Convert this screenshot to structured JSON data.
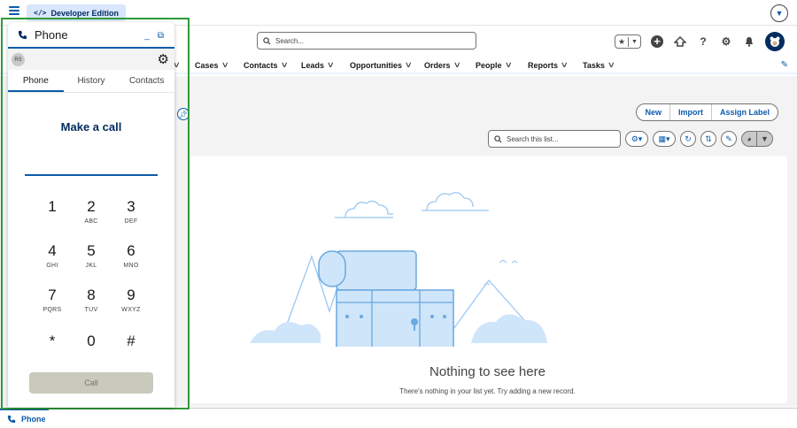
{
  "top": {
    "edition_code": "</>",
    "edition_label": "Developer Edition",
    "help_icon": "chevron-down-icon"
  },
  "header": {
    "search_placeholder": "Search..."
  },
  "nav": {
    "items": [
      {
        "label": "Cases"
      },
      {
        "label": "Contacts"
      },
      {
        "label": "Leads"
      },
      {
        "label": "Opportunities"
      },
      {
        "label": "Orders"
      },
      {
        "label": "People"
      },
      {
        "label": "Reports"
      },
      {
        "label": "Tasks"
      }
    ]
  },
  "list": {
    "buttons": [
      "New",
      "Import",
      "Assign Label"
    ],
    "search_placeholder": "Search this list...",
    "empty_title": "Nothing to see here",
    "empty_sub": "There's nothing in your list yet. Try adding a new record."
  },
  "phone": {
    "title": "Phone",
    "avatar_initials": "RS",
    "tabs": [
      "Phone",
      "History",
      "Contacts"
    ],
    "active_tab": "Phone",
    "heading": "Make a call",
    "keys": [
      {
        "digit": "1",
        "letters": ""
      },
      {
        "digit": "2",
        "letters": "ABC"
      },
      {
        "digit": "3",
        "letters": "DEF"
      },
      {
        "digit": "4",
        "letters": "GHI"
      },
      {
        "digit": "5",
        "letters": "JKL"
      },
      {
        "digit": "6",
        "letters": "MNO"
      },
      {
        "digit": "7",
        "letters": "PQRS"
      },
      {
        "digit": "8",
        "letters": "TUV"
      },
      {
        "digit": "9",
        "letters": "WXYZ"
      },
      {
        "digit": "*",
        "letters": ""
      },
      {
        "digit": "0",
        "letters": ""
      },
      {
        "digit": "#",
        "letters": ""
      }
    ],
    "call_label": "Call"
  },
  "utility": {
    "phone_label": "Phone"
  },
  "colors": {
    "brand": "#0b5cab",
    "highlight_outline": "#2e9a3a"
  }
}
